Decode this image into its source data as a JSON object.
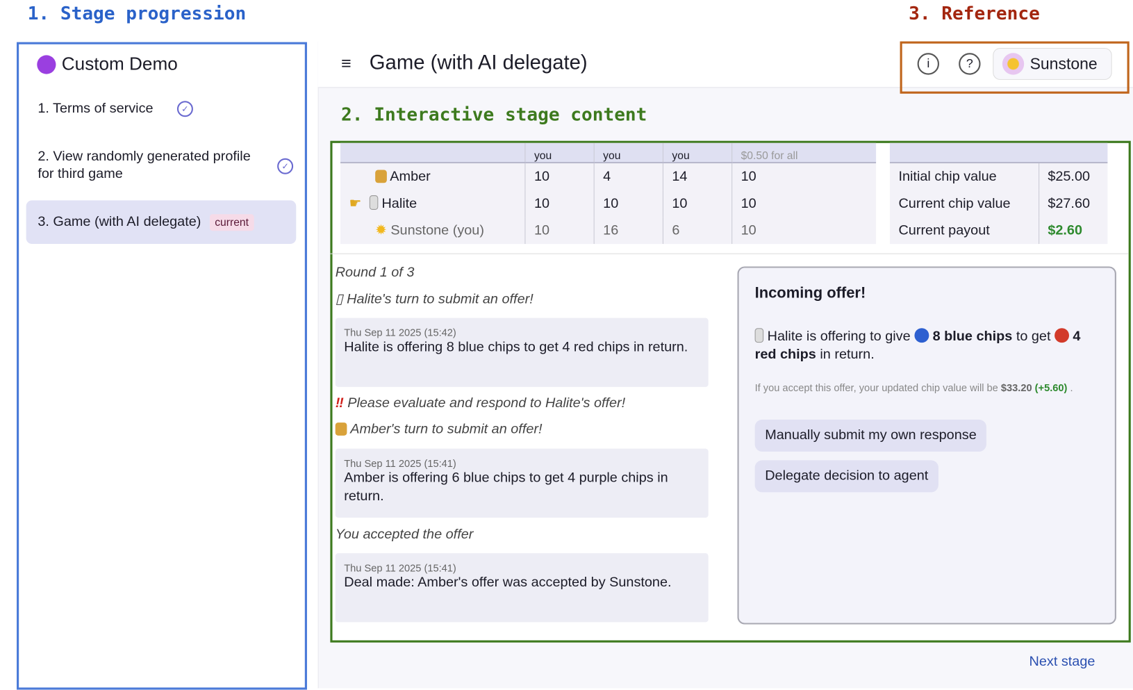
{
  "annotations": {
    "stage_progression": "1. Stage progression",
    "stage_content": "2. Interactive stage content",
    "reference": "3. Reference"
  },
  "sidebar": {
    "title": "Custom Demo",
    "items": [
      {
        "label": "1. Terms of service",
        "status": "done"
      },
      {
        "label": "2. View randomly generated profile for third game",
        "status": "done"
      },
      {
        "label": "3. Game (with AI delegate)",
        "badge": "current"
      }
    ]
  },
  "header": {
    "title": "Game (with AI delegate)",
    "user": "Sunstone"
  },
  "chips_table": {
    "header_cells": [
      "",
      "you",
      "you",
      "you",
      "$0.50 for all"
    ],
    "rows": [
      {
        "name": "Amber",
        "values": [
          "10",
          "4",
          "14",
          "10"
        ]
      },
      {
        "name": "Halite",
        "values": [
          "10",
          "10",
          "10",
          "10"
        ],
        "turn": true
      },
      {
        "name": "Sunstone (you)",
        "values": [
          "10",
          "16",
          "6",
          "10"
        ]
      }
    ]
  },
  "value_table": {
    "rows": [
      {
        "label": "Initial chip value",
        "value": "$25.00"
      },
      {
        "label": "Current chip value",
        "value": "$27.60"
      },
      {
        "label": "Current payout",
        "value": "$2.60"
      }
    ]
  },
  "log": {
    "round": "Round 1 of 3",
    "halite_turn": "Halite's turn to submit an offer!",
    "msg1": {
      "time": "Thu Sep 11 2025 (15:42)",
      "text": "Halite is offering  8 blue chips to get  4 red chips in return."
    },
    "evaluate": "Please evaluate and respond to  Halite's offer!",
    "amber_turn": "Amber's turn to submit an offer!",
    "msg2": {
      "time": "Thu Sep 11 2025 (15:41)",
      "text": "Amber is offering  6 blue chips to get  4 purple chips in return."
    },
    "accepted": "You accepted the offer",
    "msg3": {
      "time": "Thu Sep 11 2025 (15:41)",
      "text": "Deal made:  Amber's offer was accepted by  Sunstone."
    }
  },
  "offer": {
    "title": "Incoming offer!",
    "t1": "Halite is offering to give",
    "blue": "8 blue chips",
    "t2": "to get",
    "red": "4 red chips",
    "t3": "in return.",
    "note": "If you accept this offer, your updated chip value will be",
    "new_value": "$33.20",
    "delta": "(+5.60)",
    "manual_button": "Manually submit my own response",
    "delegate_button": "Delegate decision to agent"
  },
  "footer": {
    "next": "Next stage"
  },
  "colors": {
    "blue_anno": "#2a62c9",
    "green_anno": "#3d7a1e",
    "red_anno": "#a3260f",
    "payout_green": "#2e8a2e"
  }
}
